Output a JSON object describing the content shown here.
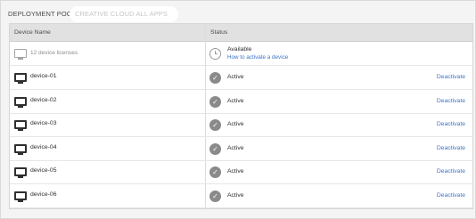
{
  "tabs": {
    "active": "DEPLOYMENT POOLS",
    "inactive": "CREATIVE CLOUD ALL APPS"
  },
  "table": {
    "headers": {
      "device_name": "Device Name",
      "status": "Status"
    },
    "pool_row": {
      "label": "12 device licenses",
      "status": "Available",
      "link": "How to activate a device",
      "icon": "clock-icon"
    },
    "devices": [
      {
        "name": "device-01",
        "status": "Active",
        "action": "Deactivate"
      },
      {
        "name": "device-02",
        "status": "Active",
        "action": "Deactivate"
      },
      {
        "name": "device-03",
        "status": "Active",
        "action": "Deactivate"
      },
      {
        "name": "device-04",
        "status": "Active",
        "action": "Deactivate"
      },
      {
        "name": "device-05",
        "status": "Active",
        "action": "Deactivate"
      },
      {
        "name": "device-06",
        "status": "Active",
        "action": "Deactivate"
      }
    ]
  },
  "icons": {
    "device": "monitor-icon",
    "active": "checkmark-icon"
  },
  "colors": {
    "link": "#3e74c6",
    "header_bg": "#e1e1e1",
    "page_bg": "#f4f4f4"
  }
}
